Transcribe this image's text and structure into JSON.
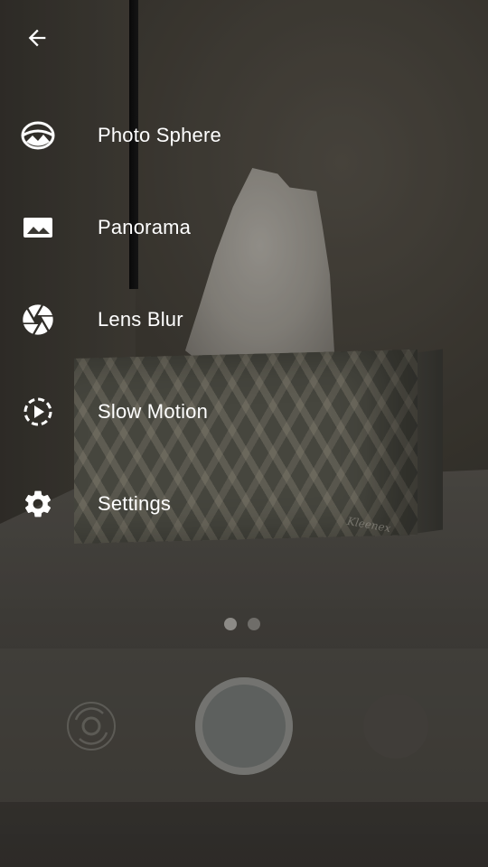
{
  "menu": {
    "back_icon": "arrow-left-icon",
    "items": [
      {
        "label": "Photo Sphere",
        "icon": "photo-sphere-icon"
      },
      {
        "label": "Panorama",
        "icon": "panorama-icon"
      },
      {
        "label": "Lens Blur",
        "icon": "aperture-icon"
      },
      {
        "label": "Slow Motion",
        "icon": "slow-motion-icon"
      },
      {
        "label": "Settings",
        "icon": "gear-icon"
      }
    ]
  },
  "viewfinder": {
    "product_text": "Kleenex"
  },
  "controls": {
    "page_count": 2,
    "active_page": 1,
    "switch_camera_icon": "switch-camera-icon",
    "shutter_icon": "shutter-button",
    "gallery_icon": "gallery-thumbnail"
  },
  "colors": {
    "text": "#ffffff",
    "overlay": "#000000"
  }
}
